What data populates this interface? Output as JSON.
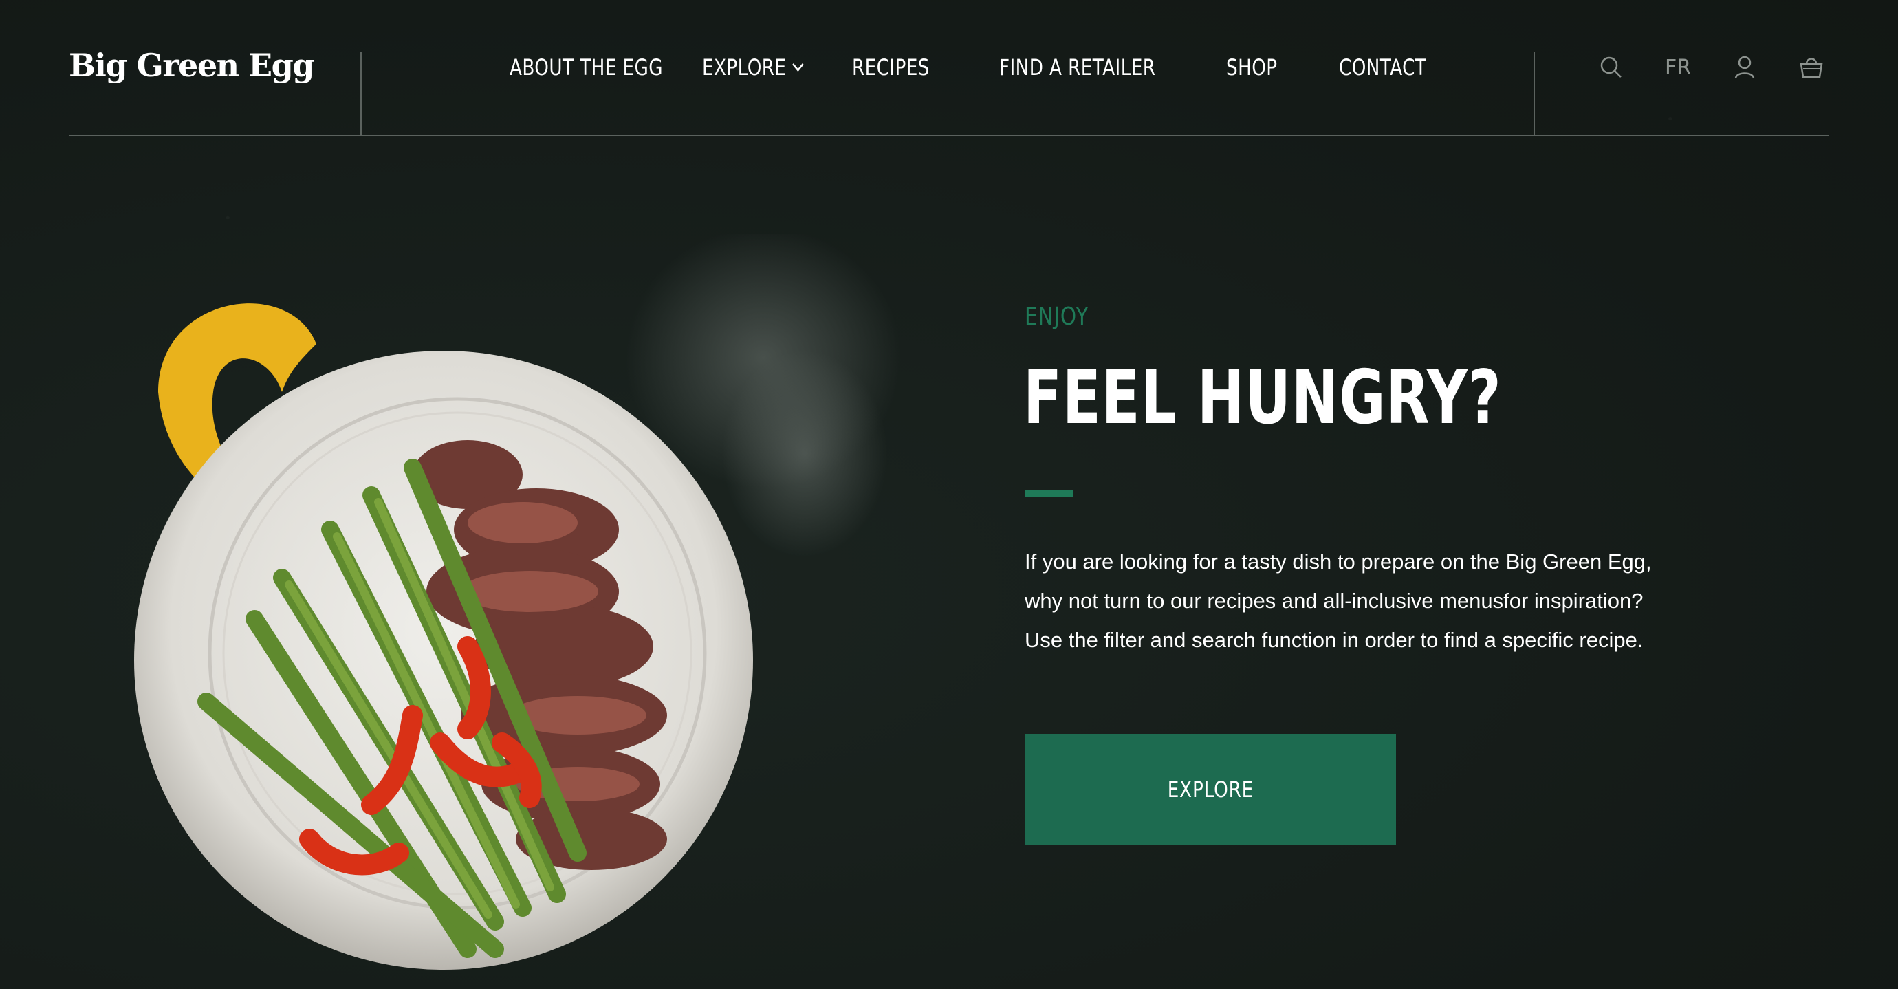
{
  "brand": {
    "logo_text": "Big Green Egg"
  },
  "nav": {
    "items": [
      {
        "label": "ABOUT THE EGG",
        "has_dropdown": true
      },
      {
        "label": "EXPLORE",
        "has_dropdown": true
      },
      {
        "label": "RECIPES",
        "has_dropdown": false
      },
      {
        "label": "FIND A RETAILER",
        "has_dropdown": false
      },
      {
        "label": "SHOP",
        "has_dropdown": false
      },
      {
        "label": "CONTACT",
        "has_dropdown": false
      }
    ]
  },
  "utility": {
    "search_icon": "search-icon",
    "language": "FR",
    "account_icon": "user-icon",
    "cart_icon": "basket-icon"
  },
  "hero": {
    "eyebrow": "ENJOY",
    "title": "FEEL HUNGRY?",
    "body_lines": [
      "If you are looking for a tasty dish to prepare on the Big Green Egg,",
      "why not turn to our recipes and all-inclusive menusfor inspiration?",
      "Use the filter and search function in order to find a specific recipe."
    ],
    "cta_label": "EXPLORE"
  },
  "colors": {
    "background": "#161c19",
    "accent": "#1f7a58",
    "button": "#1d6b50",
    "text": "#ffffff",
    "muted": "#8d938f"
  }
}
